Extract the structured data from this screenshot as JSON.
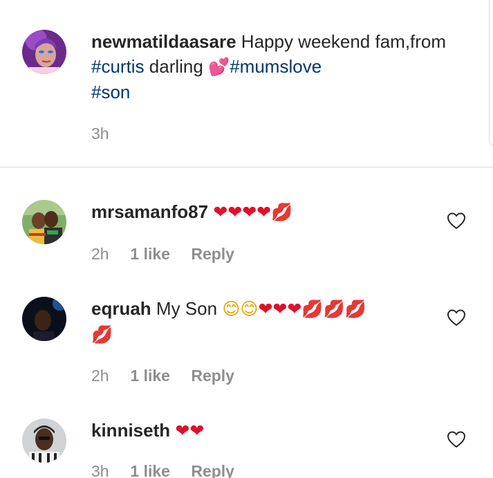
{
  "caption": {
    "username": "newmatildaasare",
    "text_parts": [
      "Happy weekend fam,from ",
      "#curtis",
      " darling ",
      "💕",
      "#mumslove",
      "#son"
    ],
    "time": "3h"
  },
  "comments": [
    {
      "username": "mrsamanfo87",
      "text": "",
      "emojis": [
        "❤",
        "❤",
        "❤",
        "❤",
        "💋"
      ],
      "time": "2h",
      "likes": "1 like",
      "reply": "Reply"
    },
    {
      "username": "eqruah",
      "text": "My Son",
      "emojis": [
        "😊",
        "😊",
        "❤",
        "❤",
        "❤",
        "💋",
        "💋",
        "💋",
        "💋"
      ],
      "time": "2h",
      "likes": "1 like",
      "reply": "Reply"
    },
    {
      "username": "kinniseth",
      "text": "",
      "emojis": [
        "❤",
        "❤"
      ],
      "time": "3h",
      "likes": "1 like",
      "reply": "Reply"
    }
  ],
  "icons": {
    "like": "heart-outline-icon"
  },
  "colors": {
    "hashtag": "#00376b",
    "meta": "#8e8e8e",
    "heart": "#e0102a"
  }
}
